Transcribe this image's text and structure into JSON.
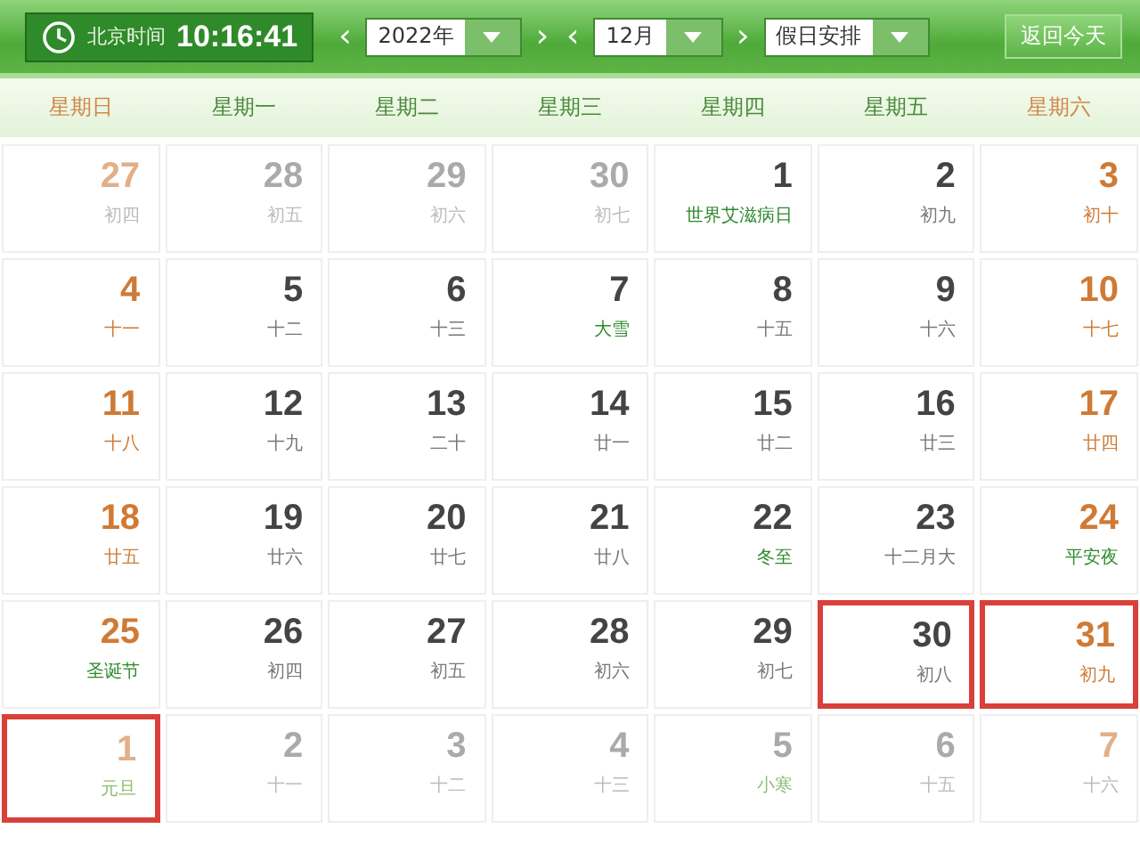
{
  "header": {
    "clock_label": "北京时间",
    "time": "10:16:41",
    "year": {
      "value": "2022年",
      "prev": "‹",
      "next": "›"
    },
    "month": {
      "value": "12月",
      "prev": "‹",
      "next": "›"
    },
    "holiday": {
      "value": "假日安排"
    },
    "today_button": "返回今天"
  },
  "weekdays": [
    {
      "label": "星期日",
      "weekend": true
    },
    {
      "label": "星期一",
      "weekend": false
    },
    {
      "label": "星期二",
      "weekend": false
    },
    {
      "label": "星期三",
      "weekend": false
    },
    {
      "label": "星期四",
      "weekend": false
    },
    {
      "label": "星期五",
      "weekend": false
    },
    {
      "label": "星期六",
      "weekend": true
    }
  ],
  "days": [
    {
      "day": "27",
      "lunar": "初四",
      "weekend": true,
      "other_month": true,
      "festival": false,
      "highlighted": false
    },
    {
      "day": "28",
      "lunar": "初五",
      "weekend": false,
      "other_month": true,
      "festival": false,
      "highlighted": false
    },
    {
      "day": "29",
      "lunar": "初六",
      "weekend": false,
      "other_month": true,
      "festival": false,
      "highlighted": false
    },
    {
      "day": "30",
      "lunar": "初七",
      "weekend": false,
      "other_month": true,
      "festival": false,
      "highlighted": false
    },
    {
      "day": "1",
      "lunar": "世界艾滋病日",
      "weekend": false,
      "other_month": false,
      "festival": true,
      "highlighted": false
    },
    {
      "day": "2",
      "lunar": "初九",
      "weekend": false,
      "other_month": false,
      "festival": false,
      "highlighted": false
    },
    {
      "day": "3",
      "lunar": "初十",
      "weekend": true,
      "other_month": false,
      "festival": false,
      "highlighted": false
    },
    {
      "day": "4",
      "lunar": "十一",
      "weekend": true,
      "other_month": false,
      "festival": false,
      "highlighted": false
    },
    {
      "day": "5",
      "lunar": "十二",
      "weekend": false,
      "other_month": false,
      "festival": false,
      "highlighted": false
    },
    {
      "day": "6",
      "lunar": "十三",
      "weekend": false,
      "other_month": false,
      "festival": false,
      "highlighted": false
    },
    {
      "day": "7",
      "lunar": "大雪",
      "weekend": false,
      "other_month": false,
      "festival": true,
      "highlighted": false
    },
    {
      "day": "8",
      "lunar": "十五",
      "weekend": false,
      "other_month": false,
      "festival": false,
      "highlighted": false
    },
    {
      "day": "9",
      "lunar": "十六",
      "weekend": false,
      "other_month": false,
      "festival": false,
      "highlighted": false
    },
    {
      "day": "10",
      "lunar": "十七",
      "weekend": true,
      "other_month": false,
      "festival": false,
      "highlighted": false
    },
    {
      "day": "11",
      "lunar": "十八",
      "weekend": true,
      "other_month": false,
      "festival": false,
      "highlighted": false
    },
    {
      "day": "12",
      "lunar": "十九",
      "weekend": false,
      "other_month": false,
      "festival": false,
      "highlighted": false
    },
    {
      "day": "13",
      "lunar": "二十",
      "weekend": false,
      "other_month": false,
      "festival": false,
      "highlighted": false
    },
    {
      "day": "14",
      "lunar": "廿一",
      "weekend": false,
      "other_month": false,
      "festival": false,
      "highlighted": false
    },
    {
      "day": "15",
      "lunar": "廿二",
      "weekend": false,
      "other_month": false,
      "festival": false,
      "highlighted": false
    },
    {
      "day": "16",
      "lunar": "廿三",
      "weekend": false,
      "other_month": false,
      "festival": false,
      "highlighted": false
    },
    {
      "day": "17",
      "lunar": "廿四",
      "weekend": true,
      "other_month": false,
      "festival": false,
      "highlighted": false
    },
    {
      "day": "18",
      "lunar": "廿五",
      "weekend": true,
      "other_month": false,
      "festival": false,
      "highlighted": false
    },
    {
      "day": "19",
      "lunar": "廿六",
      "weekend": false,
      "other_month": false,
      "festival": false,
      "highlighted": false
    },
    {
      "day": "20",
      "lunar": "廿七",
      "weekend": false,
      "other_month": false,
      "festival": false,
      "highlighted": false
    },
    {
      "day": "21",
      "lunar": "廿八",
      "weekend": false,
      "other_month": false,
      "festival": false,
      "highlighted": false
    },
    {
      "day": "22",
      "lunar": "冬至",
      "weekend": false,
      "other_month": false,
      "festival": true,
      "highlighted": false
    },
    {
      "day": "23",
      "lunar": "十二月大",
      "weekend": false,
      "other_month": false,
      "festival": false,
      "highlighted": false
    },
    {
      "day": "24",
      "lunar": "平安夜",
      "weekend": true,
      "other_month": false,
      "festival": true,
      "highlighted": false
    },
    {
      "day": "25",
      "lunar": "圣诞节",
      "weekend": true,
      "other_month": false,
      "festival": true,
      "highlighted": false
    },
    {
      "day": "26",
      "lunar": "初四",
      "weekend": false,
      "other_month": false,
      "festival": false,
      "highlighted": false
    },
    {
      "day": "27",
      "lunar": "初五",
      "weekend": false,
      "other_month": false,
      "festival": false,
      "highlighted": false
    },
    {
      "day": "28",
      "lunar": "初六",
      "weekend": false,
      "other_month": false,
      "festival": false,
      "highlighted": false
    },
    {
      "day": "29",
      "lunar": "初七",
      "weekend": false,
      "other_month": false,
      "festival": false,
      "highlighted": false
    },
    {
      "day": "30",
      "lunar": "初八",
      "weekend": false,
      "other_month": false,
      "festival": false,
      "highlighted": true
    },
    {
      "day": "31",
      "lunar": "初九",
      "weekend": true,
      "other_month": false,
      "festival": false,
      "highlighted": true
    },
    {
      "day": "1",
      "lunar": "元旦",
      "weekend": true,
      "other_month": true,
      "festival": true,
      "highlighted": true
    },
    {
      "day": "2",
      "lunar": "十一",
      "weekend": false,
      "other_month": true,
      "festival": false,
      "highlighted": false
    },
    {
      "day": "3",
      "lunar": "十二",
      "weekend": false,
      "other_month": true,
      "festival": false,
      "highlighted": false
    },
    {
      "day": "4",
      "lunar": "十三",
      "weekend": false,
      "other_month": true,
      "festival": false,
      "highlighted": false
    },
    {
      "day": "5",
      "lunar": "小寒",
      "weekend": false,
      "other_month": true,
      "festival": true,
      "highlighted": false
    },
    {
      "day": "6",
      "lunar": "十五",
      "weekend": false,
      "other_month": true,
      "festival": false,
      "highlighted": false
    },
    {
      "day": "7",
      "lunar": "十六",
      "weekend": true,
      "other_month": true,
      "festival": false,
      "highlighted": false
    }
  ]
}
